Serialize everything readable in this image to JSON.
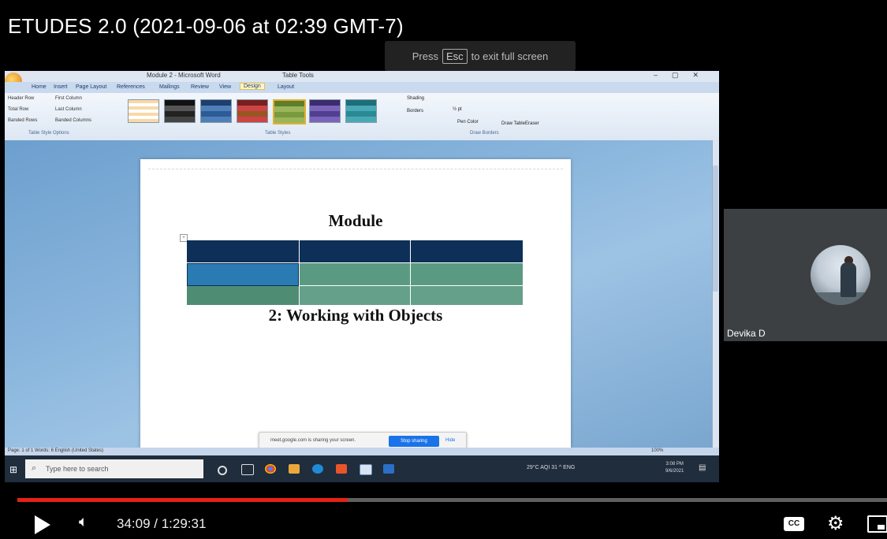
{
  "video": {
    "title": "ETUDES 2.0 (2021-09-06 at 02:39 GMT-7)",
    "esc_prefix": "Press",
    "esc_key": "Esc",
    "esc_suffix": "to exit full screen"
  },
  "word": {
    "doc_title": "Module 2 - Microsoft Word",
    "tools_title": "Table Tools",
    "tabs": [
      "Home",
      "Insert",
      "Page Layout",
      "References",
      "Mailings",
      "Review",
      "View",
      "Design",
      "Layout"
    ],
    "options": [
      "Header Row",
      "First Column",
      "Total Row",
      "Last Column",
      "Banded Rows",
      "Banded Columns"
    ],
    "group_labels": [
      "Table Style Options",
      "Table Styles",
      "Draw Borders"
    ],
    "shading_label": "Shading",
    "borders_label": "Borders",
    "pen_weight": "½ pt",
    "pen_color": "Pen Color",
    "draw_table": "Draw Table",
    "eraser": "Eraser",
    "page_title": "Module",
    "page_subtitle": "2: Working with Objects",
    "status_left": "Page: 1 of 1   Words: 6   English (United States)",
    "status_zoom": "100%"
  },
  "meet_bar": {
    "text": "meet.google.com is sharing your screen.",
    "stop_label": "Stop sharing",
    "hide_label": "Hide"
  },
  "taskbar": {
    "search_placeholder": "Type here to search",
    "tray_text": "29°C  AQI 31  ^  ENG",
    "time": "3:08 PM",
    "date": "9/6/2021"
  },
  "participant": {
    "name": "Devika D"
  },
  "player": {
    "time_display": "34:09 / 1:29:31",
    "progress_fraction": 0.38,
    "progress_color": "#e52116",
    "cc_label": "CC"
  }
}
